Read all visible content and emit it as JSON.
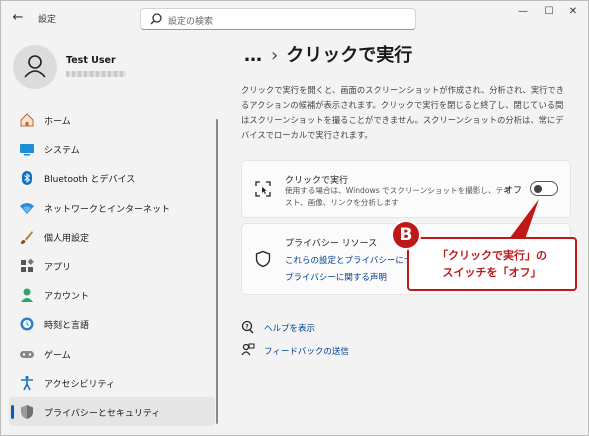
{
  "window": {
    "title": "設定",
    "back_icon": "back-arrow-icon",
    "controls": [
      "minimize",
      "maximize",
      "close"
    ]
  },
  "search": {
    "placeholder": "設定の検索"
  },
  "profile": {
    "name": "Test User"
  },
  "sidebar": {
    "items": [
      {
        "label": "ホーム",
        "icon": "home-icon",
        "active": false
      },
      {
        "label": "システム",
        "icon": "system-icon",
        "active": false
      },
      {
        "label": "Bluetooth とデバイス",
        "icon": "bluetooth-icon",
        "active": false
      },
      {
        "label": "ネットワークとインターネット",
        "icon": "network-icon",
        "active": false
      },
      {
        "label": "個人用設定",
        "icon": "brush-icon",
        "active": false
      },
      {
        "label": "アプリ",
        "icon": "apps-icon",
        "active": false
      },
      {
        "label": "アカウント",
        "icon": "account-icon",
        "active": false
      },
      {
        "label": "時刻と言語",
        "icon": "time-language-icon",
        "active": false
      },
      {
        "label": "ゲーム",
        "icon": "gamepad-icon",
        "active": false
      },
      {
        "label": "アクセシビリティ",
        "icon": "accessibility-icon",
        "active": false
      },
      {
        "label": "プライバシーとセキュリティ",
        "icon": "shield-icon",
        "active": true
      }
    ]
  },
  "breadcrumb": {
    "ellipsis": "…",
    "separator": "›",
    "current": "クリックで実行"
  },
  "description": "クリックで実行を開くと、画面のスクリーンショットが作成され、分析され、実行できるアクションの候補が表示されます。クリックで実行を閉じると終了し、閉じている間はスクリーンショットを撮ることができません。スクリーンショットの分析は、常にデバイスでローカルで実行されます。",
  "click_to_do": {
    "title": "クリックで実行",
    "subtitle": "使用する場合は、Windows でスクリーンショットを撮影し、テキスト、画像、リンクを分析します",
    "toggle_label": "オフ",
    "toggle_state": "off"
  },
  "privacy": {
    "title": "プライバシー リソース",
    "link1": "これらの設定とプライバシーにつ",
    "link2": "プライバシーに関する声明"
  },
  "help": {
    "get_help": "ヘルプを表示",
    "feedback": "フィードバックの送信"
  },
  "callout": {
    "badge": "B",
    "line1": "「クリックで実行」の",
    "line2": "スイッチを「オフ」",
    "color": "#c01818"
  }
}
